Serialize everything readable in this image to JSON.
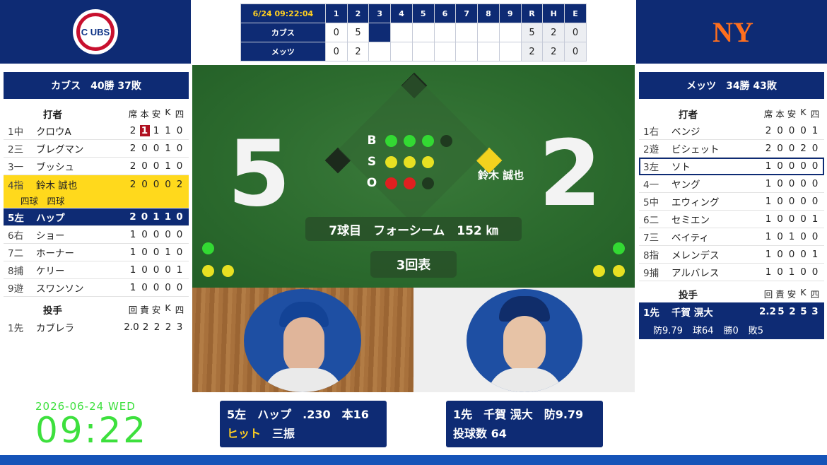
{
  "scoreboard": {
    "datetime": "6/24 09:22:04",
    "innings": [
      "1",
      "2",
      "3",
      "4",
      "5",
      "6",
      "7",
      "8",
      "9"
    ],
    "rhe": [
      "R",
      "H",
      "E"
    ],
    "teams": [
      {
        "name": "カブス",
        "scores": [
          "0",
          "5",
          "",
          "",
          "",
          "",
          "",
          "",
          ""
        ],
        "rhe": [
          "5",
          "2",
          "0"
        ]
      },
      {
        "name": "メッツ",
        "scores": [
          "0",
          "2",
          "",
          "",
          "",
          "",
          "",
          "",
          ""
        ],
        "rhe": [
          "2",
          "2",
          "0"
        ]
      }
    ]
  },
  "left": {
    "header": "カブス　40勝 37敗",
    "batter_label": "打者",
    "stat_labels": [
      "席",
      "本",
      "安",
      "K",
      "四"
    ],
    "batters": [
      {
        "pos": "1中",
        "name": "クロウA",
        "stats": [
          "2",
          "1",
          "1",
          "1",
          "0"
        ]
      },
      {
        "pos": "2三",
        "name": "ブレグマン",
        "stats": [
          "2",
          "0",
          "0",
          "1",
          "0"
        ]
      },
      {
        "pos": "3一",
        "name": "ブッシュ",
        "stats": [
          "2",
          "0",
          "0",
          "1",
          "0"
        ]
      },
      {
        "pos": "4指",
        "name": "鈴木 誠也",
        "stats": [
          "2",
          "0",
          "0",
          "0",
          "2"
        ]
      },
      {
        "pos": "5左",
        "name": "ハップ",
        "stats": [
          "2",
          "0",
          "1",
          "1",
          "0"
        ]
      },
      {
        "pos": "6右",
        "name": "ショー",
        "stats": [
          "1",
          "0",
          "0",
          "0",
          "0"
        ]
      },
      {
        "pos": "7二",
        "name": "ホーナー",
        "stats": [
          "1",
          "0",
          "0",
          "1",
          "0"
        ]
      },
      {
        "pos": "8捕",
        "name": "ケリー",
        "stats": [
          "1",
          "0",
          "0",
          "0",
          "1"
        ]
      },
      {
        "pos": "9遊",
        "name": "スワンソン",
        "stats": [
          "1",
          "0",
          "0",
          "0",
          "0"
        ]
      }
    ],
    "suzuki_detail": "四球　四球",
    "pitcher_label": "投手",
    "pitcher_stat_labels": [
      "回",
      "責",
      "安",
      "K",
      "四"
    ],
    "pitchers": [
      {
        "pos": "1先",
        "name": "カブレラ",
        "stats": [
          "2.0",
          "2",
          "2",
          "2",
          "3"
        ]
      }
    ]
  },
  "right": {
    "header": "メッツ　34勝 43敗",
    "batter_label": "打者",
    "stat_labels": [
      "席",
      "本",
      "安",
      "K",
      "四"
    ],
    "batters": [
      {
        "pos": "1右",
        "name": "ベンジ",
        "stats": [
          "2",
          "0",
          "0",
          "0",
          "1"
        ]
      },
      {
        "pos": "2遊",
        "name": "ビシェット",
        "stats": [
          "2",
          "0",
          "0",
          "2",
          "0"
        ]
      },
      {
        "pos": "3左",
        "name": "ソト",
        "stats": [
          "1",
          "0",
          "0",
          "0",
          "0"
        ]
      },
      {
        "pos": "4一",
        "name": "ヤング",
        "stats": [
          "1",
          "0",
          "0",
          "0",
          "0"
        ]
      },
      {
        "pos": "5中",
        "name": "エウィング",
        "stats": [
          "1",
          "0",
          "0",
          "0",
          "0"
        ]
      },
      {
        "pos": "6二",
        "name": "セミエン",
        "stats": [
          "1",
          "0",
          "0",
          "0",
          "1"
        ]
      },
      {
        "pos": "7三",
        "name": "ベイティ",
        "stats": [
          "1",
          "0",
          "1",
          "0",
          "0"
        ]
      },
      {
        "pos": "8指",
        "name": "メレンデス",
        "stats": [
          "1",
          "0",
          "0",
          "0",
          "1"
        ]
      },
      {
        "pos": "9捕",
        "name": "アルバレス",
        "stats": [
          "1",
          "0",
          "1",
          "0",
          "0"
        ]
      }
    ],
    "pitcher_label": "投手",
    "pitcher_stat_labels": [
      "回",
      "責",
      "安",
      "K",
      "四"
    ],
    "pitcher": {
      "pos": "1先",
      "name": "千賀 滉大",
      "stats": [
        "2.2",
        "5",
        "2",
        "5",
        "3"
      ],
      "era": "防9.79",
      "pitches": "球64",
      "wins": "勝0",
      "losses": "敗5"
    }
  },
  "field": {
    "away_score": "5",
    "home_score": "2",
    "bso_labels": [
      "B",
      "S",
      "O"
    ],
    "balls": 3,
    "strikes": 3,
    "outs": 2,
    "runner_name": "鈴木 誠也",
    "pitch_info": "7球目　フォーシーム　152 ㎞",
    "inning": "3回表"
  },
  "batter_card": {
    "line1": "5左　ハップ　.230　本16",
    "result": "ヒット",
    "extra": "三振"
  },
  "pitcher_card": {
    "line1": "1先　千賀 滉大　防9.79",
    "line2": "投球数 64"
  },
  "clock": {
    "date": "2026-06-24 WED",
    "time": "09:22"
  },
  "logos": {
    "left": "C UBS",
    "right": "NY"
  },
  "colors": {
    "navy": "#0e2b74",
    "highlight": "#ffd91c",
    "clock": "#3de03d"
  }
}
